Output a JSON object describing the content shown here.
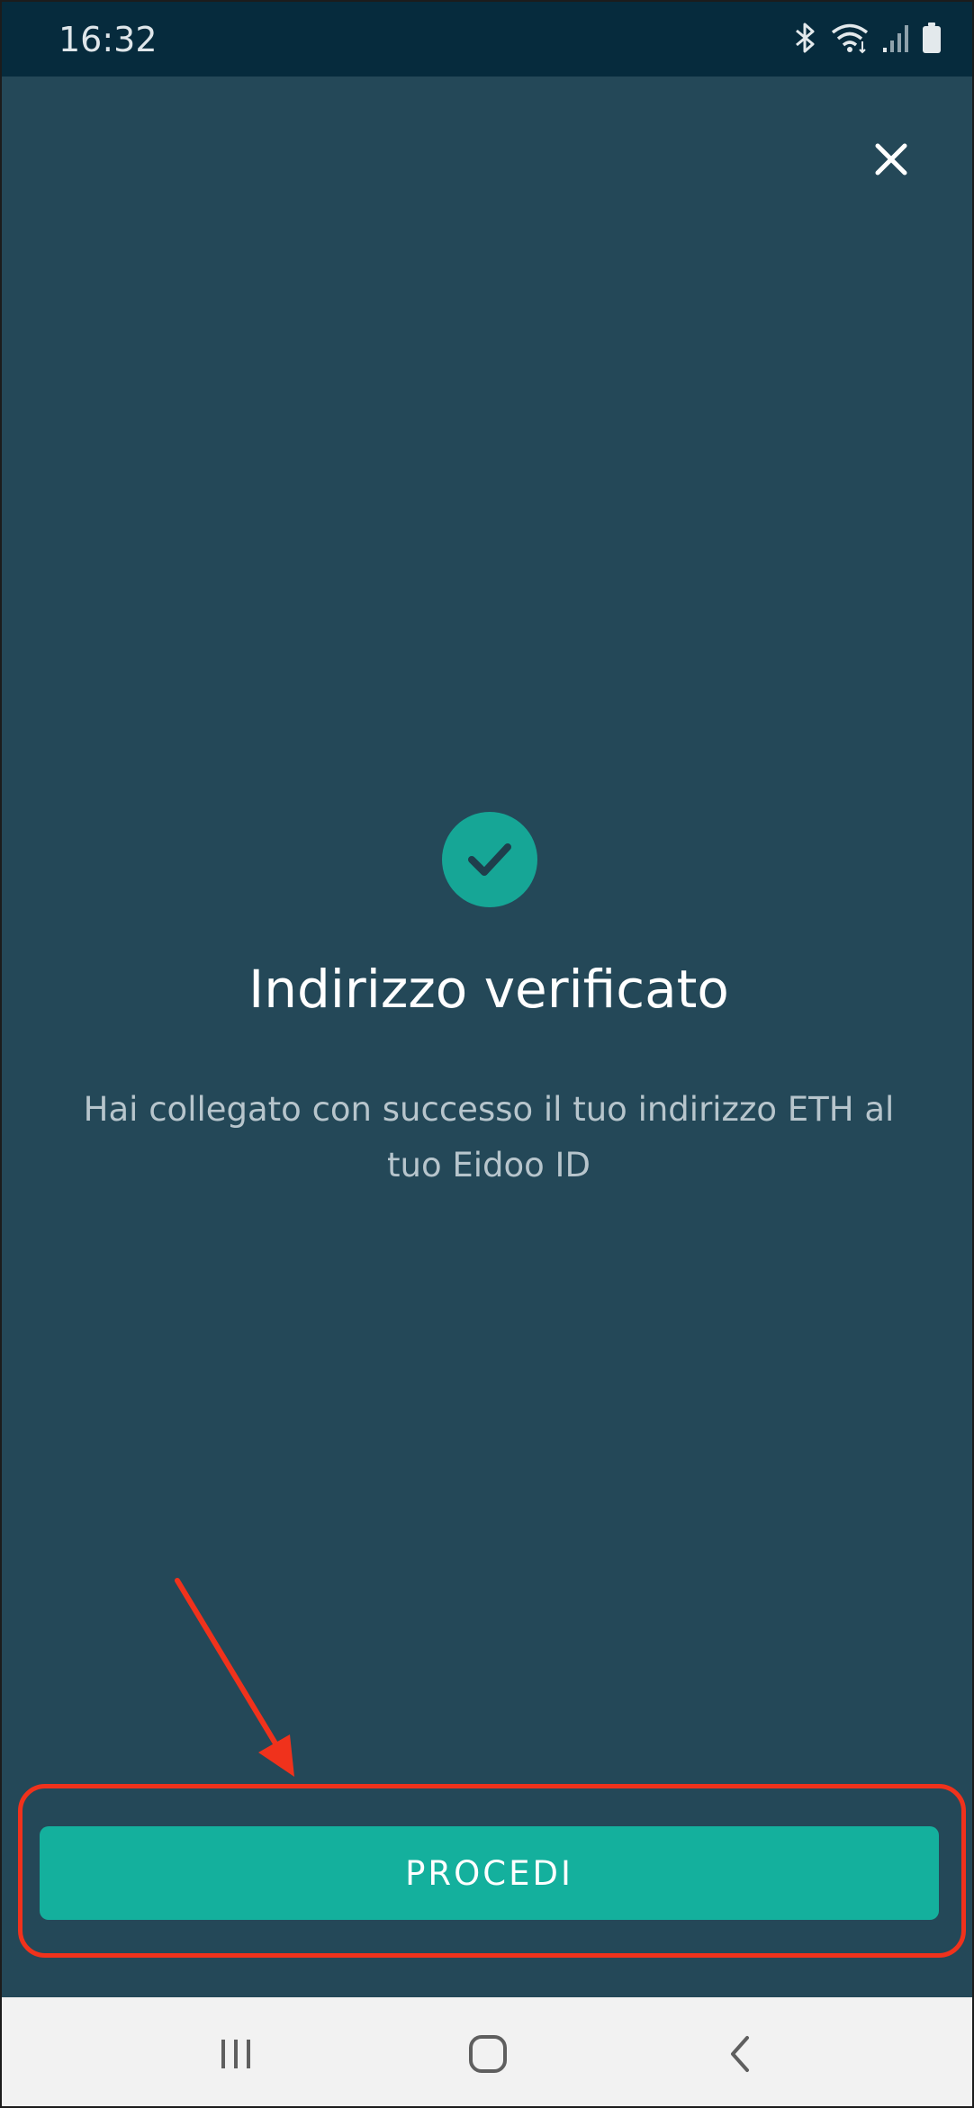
{
  "status_bar": {
    "time": "16:32",
    "icons": [
      "bluetooth-icon",
      "wifi-icon",
      "signal-icon",
      "battery-icon"
    ]
  },
  "dialog": {
    "close_icon": "close-icon",
    "check_icon": "check-circle-icon",
    "title": "Indirizzo verificato",
    "message": "Hai collegato con successo il tuo indirizzo ETH al tuo Eidoo ID",
    "proceed_label": "PROCEDI"
  },
  "nav_bar": {
    "icons": [
      "recent-apps-icon",
      "home-icon",
      "back-icon"
    ]
  },
  "colors": {
    "status_bar_bg": "#062b3d",
    "screen_bg": "#244858",
    "accent": "#14b09d",
    "annotation": "#f0321c",
    "nav_bar_bg": "#f2f2f2"
  }
}
